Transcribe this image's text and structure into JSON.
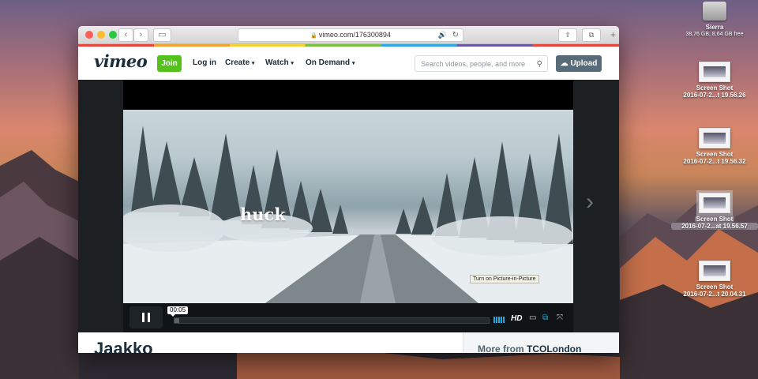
{
  "desktop": {
    "items": [
      {
        "label": "Sierra",
        "sublabel": "38,76 GB, 8,64 GB free",
        "icon": "hard-drive-icon"
      },
      {
        "label": "Screen Shot",
        "sublabel": "2016-07-2...t 19.56.26",
        "icon": "screenshot-icon"
      },
      {
        "label": "Screen Shot",
        "sublabel": "2016-07-2...t 19.56.32",
        "icon": "screenshot-icon"
      },
      {
        "label": "Screen Shot",
        "sublabel": "2016-07-2...at 19.56.57",
        "icon": "screenshot-icon",
        "selected": true
      },
      {
        "label": "Screen Shot",
        "sublabel": "2016-07-2...t 20.04.31",
        "icon": "screenshot-icon"
      }
    ]
  },
  "browser": {
    "url": "vimeo.com/176300894",
    "back_glyph": "‹",
    "forward_glyph": "›",
    "sidebar_glyph": "▭",
    "share_glyph": "⇪",
    "tabs_glyph": "⧉",
    "newtab_glyph": "+",
    "lock_glyph": "🔒",
    "audio_glyph": "🔊",
    "reload_glyph": "↻"
  },
  "vimeo_nav": {
    "logo": "vimeo",
    "join": "Join",
    "login": "Log in",
    "create": "Create",
    "watch": "Watch",
    "on_demand": "On Demand",
    "search_placeholder": "Search videos, people, and more",
    "upload": "Upload"
  },
  "player": {
    "overlay_text": "huck",
    "timecode": "00:05",
    "progress_fraction": 0.015,
    "quality": "HD",
    "tooltip": "Turn on Picture-in-Picture",
    "next_glyph": "›"
  },
  "page": {
    "video_title": "Jaakko",
    "more_from_prefix": "More from",
    "more_from_channel": "TCOLondon"
  },
  "colors": {
    "join": "#55c11d",
    "upload": "#576b79",
    "volume": "#25a7e0"
  }
}
